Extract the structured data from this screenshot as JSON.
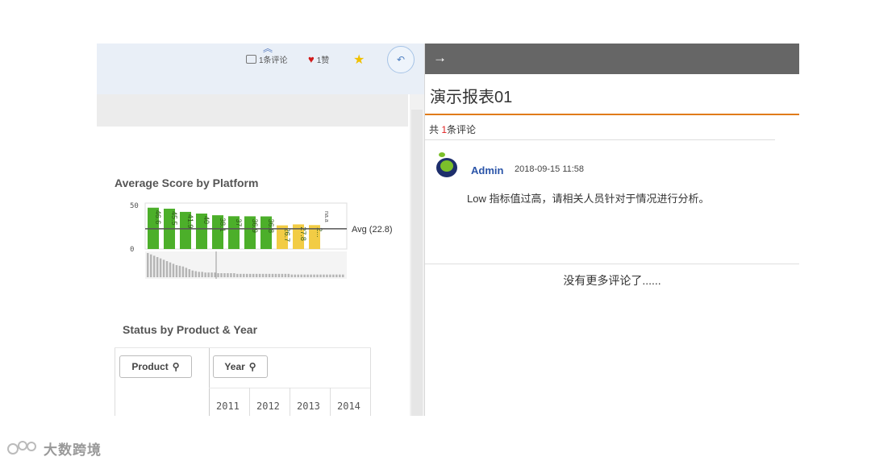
{
  "toolbar": {
    "comment_count_label": "1条评论",
    "like_count_label": "1赞",
    "expand_icon": "double-chevron-up-icon",
    "share_icon": "share-icon",
    "star_icon": "star-icon"
  },
  "dashboard": {
    "chart_data": {
      "type": "bar",
      "title": "Average Score by Platform",
      "yticks": [
        "50",
        "0"
      ],
      "ylim": [
        0,
        50
      ],
      "values": [
        46.6,
        45.5,
        41.9,
        40.0,
        38.1,
        37.0,
        36.9,
        36.8,
        26.7,
        27.8,
        27.0
      ],
      "value_labels": [
        "46.6",
        "45.5",
        "41.9",
        "40",
        "38.1",
        "37",
        "36.9",
        "36.8",
        "26.7",
        "27.8",
        "2..."
      ],
      "reference_line": {
        "label": "Avg (22.8)",
        "value": 22.8
      },
      "extra_label": "na.a",
      "colors": {
        "above": "#4caf2a",
        "below": "#f2cc45",
        "mini": "#b5b5b5"
      },
      "mini_values": [
        36,
        34,
        32,
        30,
        28,
        26,
        24,
        22,
        20,
        18,
        17,
        16,
        14,
        12,
        10,
        9,
        8,
        8,
        7,
        7,
        7,
        7,
        6,
        6,
        6,
        6,
        6,
        6,
        5,
        5,
        5,
        5,
        5,
        5,
        5,
        5,
        5,
        5,
        5,
        5,
        5,
        5,
        5,
        5,
        5,
        4,
        4,
        4,
        4,
        4,
        4,
        4,
        4,
        4,
        4,
        4,
        4,
        4,
        4,
        4,
        4,
        4
      ]
    },
    "pivot": {
      "title": "Status by Product & Year",
      "product_filter": "Product",
      "year_filter": "Year",
      "years": [
        "2011",
        "2012",
        "2013",
        "2014"
      ]
    }
  },
  "panel": {
    "report_title": "演示报表01",
    "count_prefix": "共 ",
    "count_number": "1",
    "count_suffix": "条评论",
    "comment": {
      "author": "Admin",
      "time": "2018-09-15 11:58",
      "text": "Low 指标值过高，请相关人员针对于情况进行分析。"
    },
    "no_more": "没有更多评论了......"
  },
  "watermark": {
    "text": "大数跨境"
  },
  "colors": {
    "accent": "#e07b1a",
    "link_blue": "#2a54a8",
    "header_gray": "#666666"
  }
}
